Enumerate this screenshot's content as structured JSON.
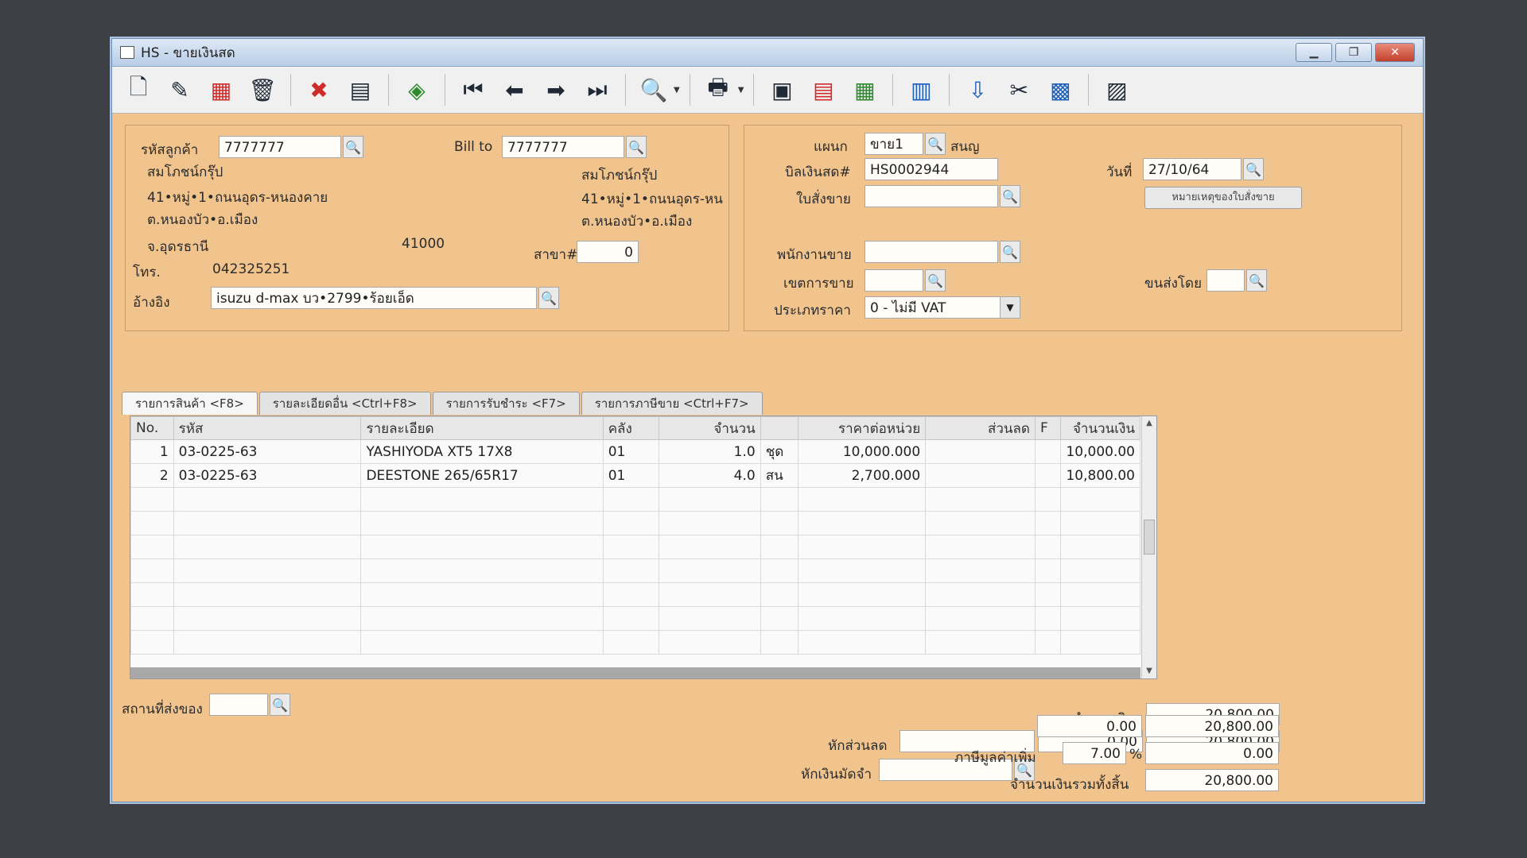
{
  "window": {
    "title": "HS - ขายเงินสด",
    "controls": [
      "▁",
      "❐",
      "✕"
    ]
  },
  "toolbar": {
    "buttons": [
      {
        "name": "new-document",
        "glyph": "🗋"
      },
      {
        "name": "edit",
        "glyph": "✎"
      },
      {
        "name": "void",
        "glyph": "▦"
      },
      {
        "name": "delete-trash",
        "glyph": "🗑"
      },
      {
        "name": "cancel",
        "glyph": "✖"
      },
      {
        "name": "save",
        "glyph": "▤"
      },
      {
        "name": "copy",
        "glyph": "◈"
      },
      {
        "name": "first-record",
        "glyph": "⏮"
      },
      {
        "name": "previous-record",
        "glyph": "⬅"
      },
      {
        "name": "next-record",
        "glyph": "➡"
      },
      {
        "name": "last-record",
        "glyph": "⏭"
      },
      {
        "name": "search-document",
        "glyph": "🔍"
      },
      {
        "name": "print",
        "glyph": "🖶"
      },
      {
        "name": "report-1",
        "glyph": "▣"
      },
      {
        "name": "report-2",
        "glyph": "▤"
      },
      {
        "name": "calculator",
        "glyph": "▦"
      },
      {
        "name": "refund",
        "glyph": "▥"
      },
      {
        "name": "approve-ok",
        "glyph": "⇩"
      },
      {
        "name": "tools",
        "glyph": "✂"
      },
      {
        "name": "confirm-ok",
        "glyph": "▩"
      },
      {
        "name": "import",
        "glyph": "▨"
      }
    ]
  },
  "customer": {
    "code_label": "รหัสลูกค้า",
    "code_value": "7777777",
    "name": "สมโภชน์กรุ๊ป",
    "address1": "41•หมู่•1•ถนนอุดร-หนองคาย",
    "address2": "ต.หนองบัว•อ.เมือง",
    "address3": "จ.อุดรธานี",
    "postcode": "41000",
    "tel_label": "โทร.",
    "tel_value": "042325251",
    "ref_label": "อ้างอิง",
    "ref_value": "isuzu d-max บว•2799•ร้อยเอ็ด"
  },
  "billto": {
    "label": "Bill to",
    "value": "7777777",
    "name": "สมโภชน์กรุ๊ป",
    "address1": "41•หมู่•1•ถนนอุดร-หน",
    "address2": "ต.หนองบัว•อ.เมือง",
    "branch_label": "สาขา#",
    "branch_value": "0"
  },
  "doc": {
    "dept_label": "แผนก",
    "dept_value": "ขาย1",
    "dept_name": "สนญ",
    "bill_label": "บิลเงินสด#",
    "bill_value": "HS0002944",
    "date_label": "วันที่",
    "date_value": "27/10/64",
    "order_label": "ใบสั่งขาย",
    "order_value": "",
    "order_note_button": "หมายเหตุของใบสั่งขาย",
    "salesman_label": "พนักงานขาย",
    "salesman_value": "",
    "area_label": "เขตการขาย",
    "area_value": "",
    "shipping_label": "ขนส่งโดย",
    "shipping_value": "",
    "pricetype_label": "ประเภทราคา",
    "pricetype_value": "0 - ไม่มี VAT"
  },
  "tabs": [
    "รายการสินค้า <F8>",
    "รายละเอียดอื่น <Ctrl+F8>",
    "รายการรับชำระ <F7>",
    "รายการภาษีขาย <Ctrl+F7>"
  ],
  "grid": {
    "headers": [
      "No.",
      "รหัส",
      "รายละเอียด",
      "คลัง",
      "จำนวน",
      "",
      "ราคาต่อหน่วย",
      "ส่วนลด",
      "F",
      "จำนวนเงิน"
    ],
    "rows": [
      [
        "1",
        "03-0225-63",
        "YASHIYODA XT5 17X8",
        "01",
        "1.0",
        "ชุด",
        "10,000.000",
        "",
        "",
        "10,000.00"
      ],
      [
        "2",
        "03-0225-63",
        "DEESTONE 265/65R17",
        "01",
        "4.0",
        "สน",
        "2,700.000",
        "",
        "",
        "10,800.00"
      ]
    ],
    "empty_rows": 7
  },
  "footer": {
    "ship_place_label": "สถานที่ส่งของ",
    "ship_place_value": "",
    "amount_label": "จำนวนเงิน",
    "amount_value": "20,800.00",
    "discount_label": "หักส่วนลด",
    "discount_text": "",
    "discount_amount": "0.00",
    "after_discount": "20,800.00",
    "deposit_label": "หักเงินมัดจำ",
    "deposit_text": "",
    "deposit_amount": "0.00",
    "after_deposit": "20,800.00",
    "vat_label": "ภาษีมูลค่าเพิ่ม",
    "vat_rate": "7.00",
    "vat_percent": "%",
    "vat_amount": "0.00",
    "total_label": "จำนวนเงินรวมทั้งสิ้น",
    "total_value": "20,800.00"
  }
}
